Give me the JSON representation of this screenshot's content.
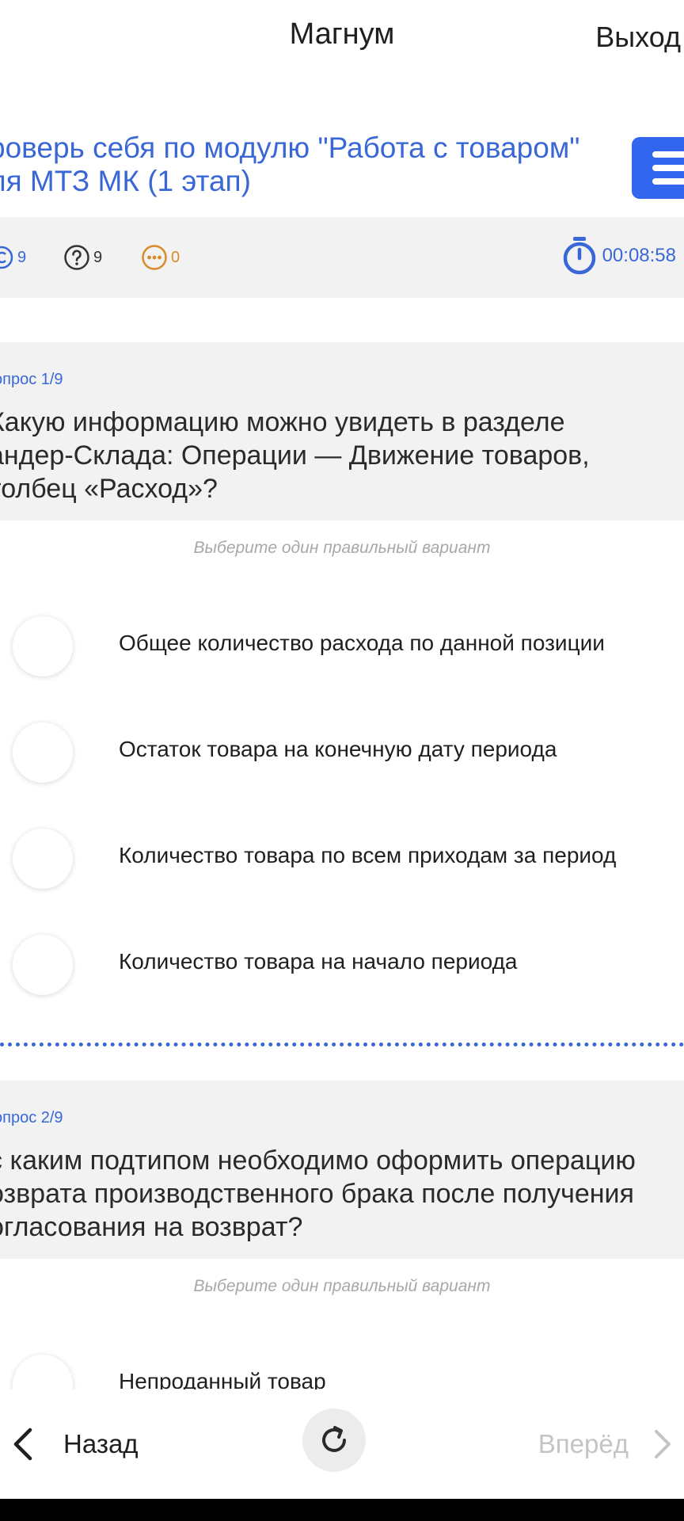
{
  "header": {
    "title": "Магнум",
    "exit_label": "Выход"
  },
  "test": {
    "title_lines": [
      "роверь себя по модулю \"Работа с товаром\"",
      "ля МТЗ МК (1 этап)"
    ]
  },
  "stats": {
    "answered": "9",
    "total": "9",
    "skipped": "0",
    "timer": "00:08:58"
  },
  "questions": [
    {
      "number": "опрос 1/9",
      "text_lines": [
        "Какую информацию можно увидеть в разделе",
        "андер-Склада: Операции — Движение товаров,",
        "толбец «Расход»?"
      ],
      "hint": "Выберите один правильный вариант",
      "options": [
        "Общее количество расхода по данной позиции",
        "Остаток товара на конечную дату периода",
        "Количество товара по всем приходам за период",
        "Количество товара на начало периода"
      ]
    },
    {
      "number": "опрос 2/9",
      "text_lines": [
        "с каким подтипом необходимо оформить операцию",
        "озврата производственного брака после получения",
        "огласования на возврат?"
      ],
      "hint": "Выберите один правильный вариант",
      "options": [
        "Непроданный товар"
      ]
    }
  ],
  "nav": {
    "back_label": "Назад",
    "forward_label": "Вперёд"
  },
  "colors": {
    "accent": "#3a67d6",
    "menu_button": "#3366ee",
    "skipped": "#d98a2a",
    "panel_bg": "#f2f2f2"
  }
}
